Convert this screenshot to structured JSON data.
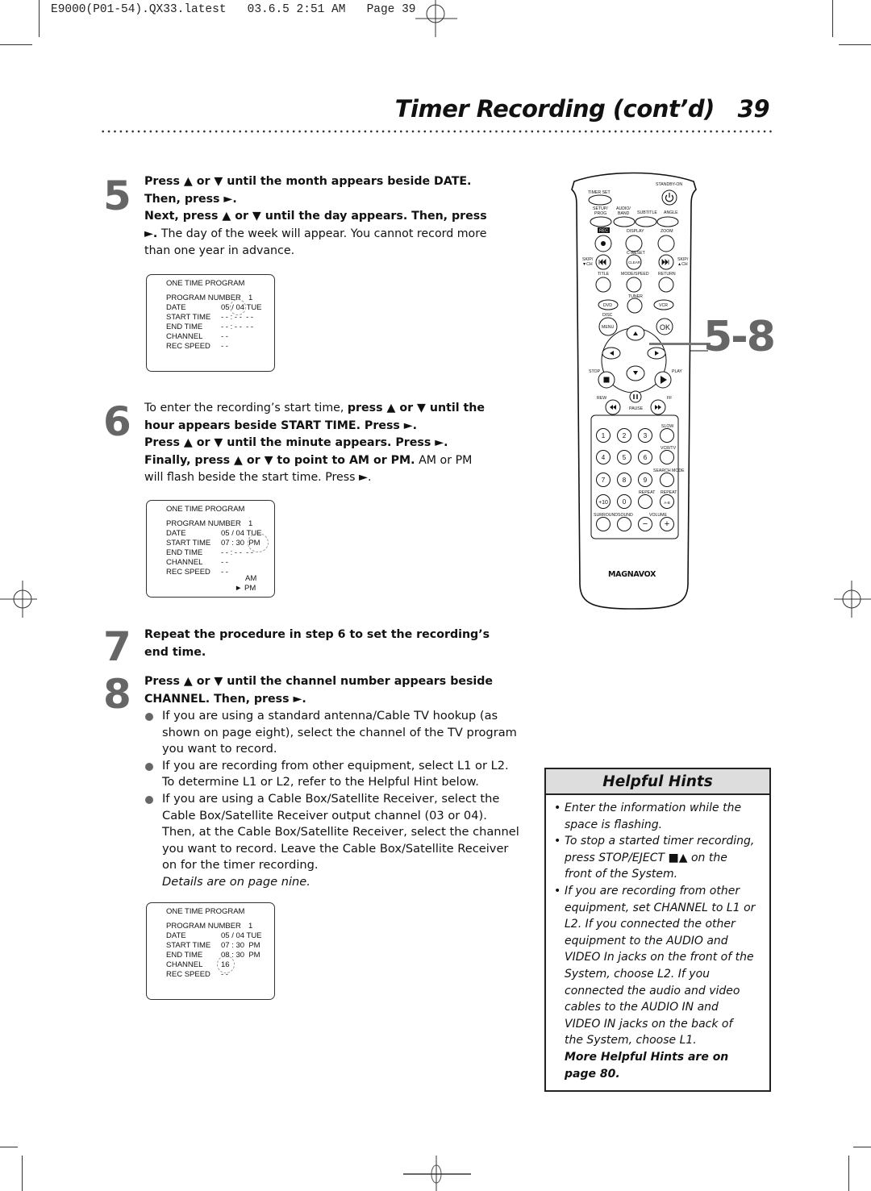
{
  "slug": {
    "text": "E9000(P01-54).QX33.latest   03.6.5 2:51 AM   Page 39"
  },
  "header": {
    "title": "Timer Recording (cont’d)",
    "page_number": "39"
  },
  "steps": {
    "s5": {
      "number": "5",
      "line1_bold": "Press ▲ or ▼ until the month appears beside DATE.",
      "line2_bold": "Then, press ►.",
      "line3_bold": "Next, press ▲ or ▼ until the day appears. Then, press",
      "line4_bold": "►.",
      "line4_rest": " The day of the week will appear. You cannot record more",
      "line5": "than one year in advance."
    },
    "s6": {
      "number": "6",
      "line1_plain": "To enter the recording’s start time, ",
      "line1_bold": "press ▲ or ▼ until the",
      "line2_bold": "hour appears beside START TIME.  Press ►.",
      "line3_bold": "Press ▲ or ▼ until the minute appears.  Press ►.",
      "line4_bold": "Finally, press ▲ or ▼ to point to AM or PM.",
      "line4_rest": " AM or PM",
      "line5": "will flash beside the start time. Press ►."
    },
    "s7": {
      "number": "7",
      "line1_bold": "Repeat the procedure in step 6 to set the recording’s",
      "line2_bold": "end time."
    },
    "s8": {
      "number": "8",
      "line1_bold": "Press ▲ or ▼ until the channel number appears beside",
      "line2_bold": "CHANNEL. Then, press ►.",
      "bullets": [
        [
          "If you are using a standard antenna/Cable TV hookup (as",
          "shown on page eight), select the channel of the TV program",
          "you want to record."
        ],
        [
          "If you are recording from other equipment, select L1 or L2.",
          "To determine L1 or L2, refer to the Helpful Hint below."
        ],
        [
          "If you are using a Cable Box/Satellite Receiver, select the",
          "Cable Box/Satellite Receiver output channel (03 or 04).",
          "Then, at the Cable Box/Satellite Receiver, select the channel",
          "you want to record. Leave the Cable Box/Satellite Receiver",
          "on for the timer recording."
        ]
      ],
      "details_note": "Details are on page nine."
    }
  },
  "screens": {
    "labels": {
      "title": "ONE TIME PROGRAM",
      "program_number": "PROGRAM NUMBER",
      "date": "DATE",
      "start_time": "START TIME",
      "end_time": "END TIME",
      "channel": "CHANNEL",
      "rec_speed": "REC SPEED"
    },
    "screen1": {
      "program_number": "1",
      "date": "05 / 04 TUE",
      "start_time": "- - : - -  - -",
      "end_time": "- - : - -  - -",
      "channel": "- -",
      "rec_speed": "- -"
    },
    "screen2": {
      "program_number": "1",
      "date": "05 / 04 TUE",
      "start_time": "07 : 30  PM",
      "end_time": "- - : - -  - -",
      "channel": "- -",
      "rec_speed": "- -",
      "option_am": "AM",
      "option_pm": "► PM"
    },
    "screen3": {
      "program_number": "1",
      "date": "05 / 04 TUE",
      "start_time": "07 : 30  PM",
      "end_time": "08 : 30  PM",
      "channel": "16",
      "rec_speed": "- -"
    }
  },
  "remote": {
    "brand": "MAGNAVOX",
    "step_ref": "5-8",
    "labels": {
      "standby": "STANDBY-ON",
      "timer_set": "TIMER SET",
      "setup_1": "SETUP/",
      "setup_2": "PROG",
      "audio_1": "AUDIO/",
      "audio_2": "BAND",
      "subtitle": "SUBTITLE",
      "angle": "ANGLE",
      "rec": "REC",
      "display": "DISPLAY",
      "zoom": "ZOOM",
      "creset": "C-RESET",
      "skip_left_1": "SKIP/",
      "skip_left_2": "▼CH",
      "skip_right_1": "SKIP/",
      "skip_right_2": "▲CH",
      "clear": "CLEAR",
      "title": "TITLE",
      "mode_speed": "MODE/SPEED",
      "return": "RETURN",
      "tuner": "TUNER",
      "dvd": "DVD",
      "vcr": "VCR",
      "disc": "DISC",
      "menu": "MENU",
      "ok": "OK",
      "stop": "STOP",
      "play": "PLAY",
      "rew": "REW",
      "ff": "FF",
      "pause": "PAUSE",
      "slow": "SLOW",
      "vcrtv": "VCR/TV",
      "search_mode": "SEARCH MODE",
      "repeat": "REPEAT",
      "repeat_ab": "REPEAT",
      "ab": "A-B",
      "surround": "SURROUND",
      "sound": "SOUND",
      "volume": "VOLUME",
      "digits": [
        "1",
        "2",
        "3",
        "4",
        "5",
        "6",
        "7",
        "8",
        "9",
        "+10",
        "0"
      ]
    }
  },
  "helpful_hints": {
    "heading": "Helpful Hints",
    "bullet_char": "•",
    "hints": [
      [
        "Enter the information while the",
        "space is flashing."
      ],
      [
        "To stop a started timer recording,",
        "press STOP/EJECT ■▲ on the",
        "front of the System."
      ],
      [
        "If you are recording from other",
        "equipment, set CHANNEL to L1 or",
        "L2. If you connected the other",
        "equipment to the AUDIO and",
        "VIDEO In jacks on the front of the",
        "System, choose L2. If you",
        "connected the audio and video",
        "cables to the AUDIO IN and",
        "VIDEO IN jacks on the back of",
        "the System, choose L1."
      ]
    ],
    "more_1": "More Helpful Hints are on",
    "more_2": "page 80."
  }
}
